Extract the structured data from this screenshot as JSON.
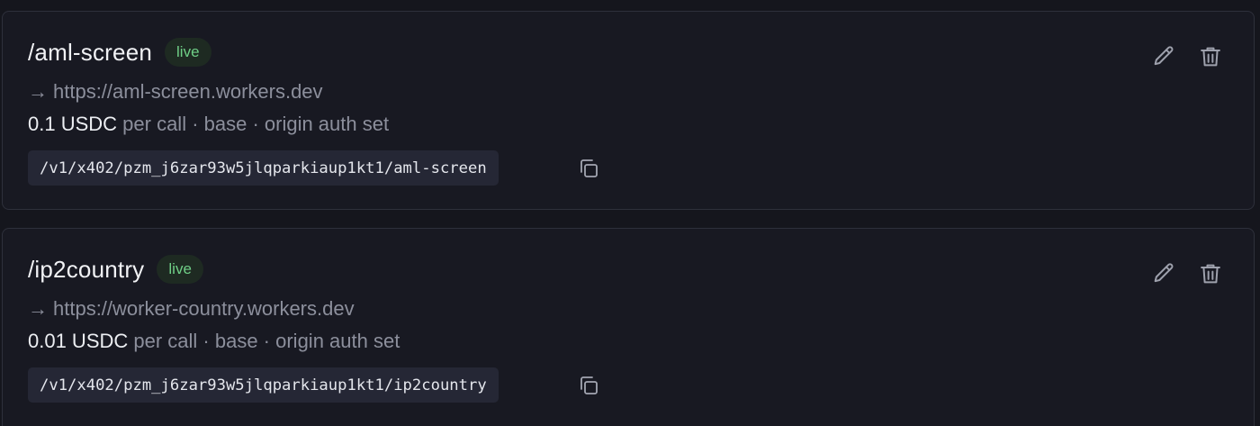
{
  "routes": [
    {
      "path": "/aml-screen",
      "status": "live",
      "target_arrow": "→",
      "target_url": "https://aml-screen.workers.dev",
      "price": "0.1 USDC",
      "details": " per call · base · origin auth set",
      "endpoint": "/v1/x402/pzm_j6zar93w5jlqparkiaup1kt1/aml-screen"
    },
    {
      "path": "/ip2country",
      "status": "live",
      "target_arrow": "→",
      "target_url": "https://worker-country.workers.dev",
      "price": "0.01 USDC",
      "details": " per call · base · origin auth set",
      "endpoint": "/v1/x402/pzm_j6zar93w5jlqparkiaup1kt1/ip2country"
    }
  ],
  "icons": {
    "edit": "pencil-icon",
    "delete": "trash-icon",
    "copy": "copy-icon"
  },
  "colors": {
    "background": "#15161d",
    "card": "#181922",
    "badge_bg": "#1e2a22",
    "badge_text": "#6fce86",
    "muted": "#8c8f9c",
    "code_bg": "#252735"
  }
}
